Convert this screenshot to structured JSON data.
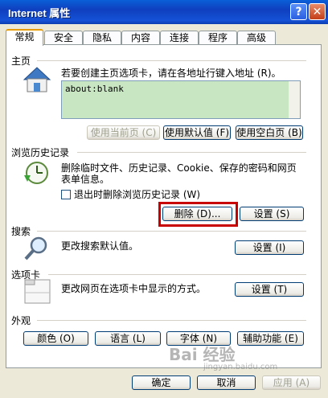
{
  "window": {
    "title": "Internet 属性",
    "help_glyph": "?",
    "close_glyph": "✕"
  },
  "tabs": [
    "常规",
    "安全",
    "隐私",
    "内容",
    "连接",
    "程序",
    "高级"
  ],
  "home": {
    "section": "主页",
    "description": "若要创建主页选项卡，请在各地址行键入地址 (R)。",
    "address": "about:blank",
    "btn_current": "使用当前页 (C)",
    "btn_default": "使用默认值 (F)",
    "btn_blank": "使用空白页 (B)"
  },
  "history": {
    "section": "浏览历史记录",
    "description_1": "删除临时文件、历史记录、Cookie、保存的密码和网页",
    "description_2": "表单信息。",
    "checkbox_label": "退出时删除浏览历史记录 (W)",
    "delete_btn": "删除 (D)...",
    "settings_btn": "设置 (S)"
  },
  "search": {
    "section": "搜索",
    "description": "更改搜索默认值。",
    "settings_btn": "设置 (I)"
  },
  "tabs_section": {
    "section": "选项卡",
    "description": "更改网页在选项卡中显示的方式。",
    "settings_btn": "设置 (T)"
  },
  "appearance": {
    "section": "外观",
    "colors": "颜色 (O)",
    "languages": "语言 (L)",
    "fonts": "字体 (N)",
    "accessibility": "辅助功能 (E)"
  },
  "footer": {
    "ok": "确定",
    "cancel": "取消",
    "apply": "应用 (A)"
  },
  "watermark": {
    "text": "Bai 经验",
    "url": "jingyan.baidu.com"
  }
}
